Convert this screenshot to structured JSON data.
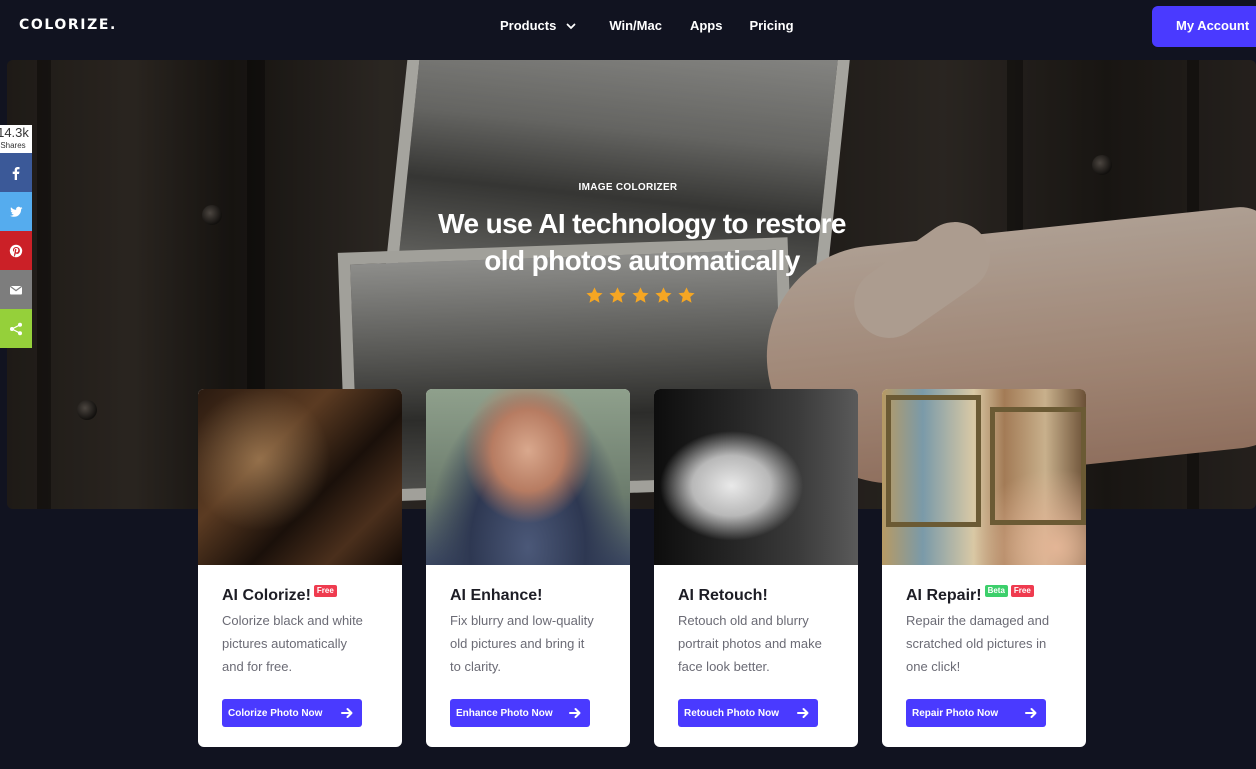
{
  "nav": {
    "logo": "COLORIZE.",
    "links": [
      "Products",
      "Win/Mac",
      "Apps",
      "Pricing"
    ],
    "account_label": "My Account"
  },
  "hero": {
    "eyebrow": "IMAGE COLORIZER",
    "title_line1": "We use AI technology to restore",
    "title_line2": "old photos automatically",
    "rating_stars": 5
  },
  "share": {
    "count": "14.3k",
    "label": "Shares",
    "buttons": [
      {
        "icon": "facebook-icon",
        "color": "#3b5998"
      },
      {
        "icon": "twitter-icon",
        "color": "#55acee"
      },
      {
        "icon": "pinterest-icon",
        "color": "#cb2027"
      },
      {
        "icon": "email-icon",
        "color": "#7d7d7d"
      },
      {
        "icon": "share-icon",
        "color": "#95d03a"
      }
    ]
  },
  "cards": [
    {
      "title": "AI Colorize!",
      "badges": [
        "Free"
      ],
      "desc_lines": [
        "Colorize black and white",
        "pictures automatically",
        "and for free."
      ],
      "button": "Colorize Photo Now"
    },
    {
      "title": "AI Enhance!",
      "badges": [],
      "desc_lines": [
        "Fix blurry and low-quality",
        "old pictures and bring it",
        "to clarity."
      ],
      "button": "Enhance Photo Now"
    },
    {
      "title": "AI Retouch!",
      "badges": [],
      "desc_lines": [
        "Retouch old and blurry",
        "portrait photos and make",
        "face look better."
      ],
      "button": "Retouch Photo Now"
    },
    {
      "title": "AI Repair!",
      "badges": [
        "Beta",
        "Free"
      ],
      "desc_lines": [
        "Repair the damaged and",
        "scratched old pictures in",
        "one click!"
      ],
      "button": "Repair Photo Now"
    }
  ],
  "colors": {
    "background": "#111320",
    "accent": "#4a3aff",
    "star": "#f5a623",
    "badge_free": "#ef3b4f",
    "badge_beta": "#3ccf6b"
  }
}
